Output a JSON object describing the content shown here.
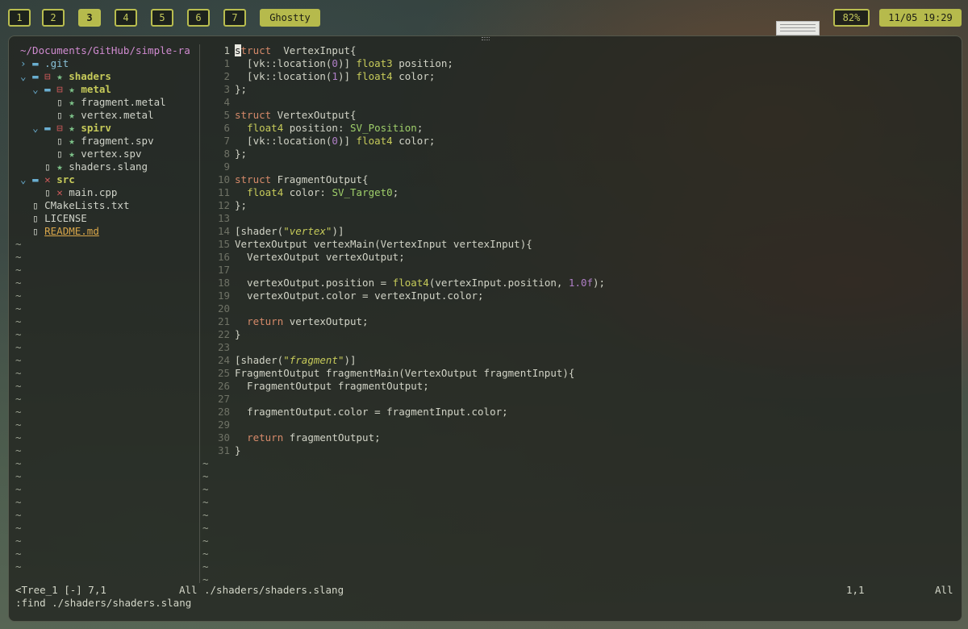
{
  "topbar": {
    "workspaces": [
      "1",
      "2",
      "3",
      "4",
      "5",
      "6",
      "7"
    ],
    "active_workspace": "3",
    "app_label": "Ghostty",
    "battery": "82%",
    "clock": "11/05 19:29"
  },
  "tree": {
    "root": "~/Documents/GitHub/simple-ra",
    "items": [
      {
        "indent": 1,
        "chev": "›",
        "icon": "folder",
        "marks": "",
        "name": ".git",
        "cls": "c-dir"
      },
      {
        "indent": 1,
        "chev": "⌄",
        "icon": "folder",
        "marks": "⊟ ★",
        "name": "shaders",
        "cls": "c-dir-b"
      },
      {
        "indent": 2,
        "chev": "⌄",
        "icon": "folder",
        "marks": "⊟ ★",
        "name": "metal",
        "cls": "c-dir-b"
      },
      {
        "indent": 3,
        "chev": "",
        "icon": "file",
        "marks": "★",
        "name": "fragment.metal",
        "cls": "c-file"
      },
      {
        "indent": 3,
        "chev": "",
        "icon": "file",
        "marks": "★",
        "name": "vertex.metal",
        "cls": "c-file"
      },
      {
        "indent": 2,
        "chev": "⌄",
        "icon": "folder",
        "marks": "⊟ ★",
        "name": "spirv",
        "cls": "c-dir-b"
      },
      {
        "indent": 3,
        "chev": "",
        "icon": "file",
        "marks": "★",
        "name": "fragment.spv",
        "cls": "c-file"
      },
      {
        "indent": 3,
        "chev": "",
        "icon": "file",
        "marks": "★",
        "name": "vertex.spv",
        "cls": "c-file"
      },
      {
        "indent": 2,
        "chev": "",
        "icon": "file",
        "marks": "★",
        "name": "shaders.slang",
        "cls": "c-file"
      },
      {
        "indent": 1,
        "chev": "⌄",
        "icon": "folder",
        "marks": "✕",
        "name": "src",
        "cls": "c-dir-b"
      },
      {
        "indent": 2,
        "chev": "",
        "icon": "file",
        "marks": "✕",
        "name": "main.cpp",
        "cls": "c-file"
      },
      {
        "indent": 1,
        "chev": "",
        "icon": "file",
        "marks": "",
        "name": "CMakeLists.txt",
        "cls": "c-file"
      },
      {
        "indent": 1,
        "chev": "",
        "icon": "file",
        "marks": "",
        "name": "LICENSE",
        "cls": "c-file"
      },
      {
        "indent": 1,
        "chev": "",
        "icon": "file",
        "marks": "",
        "name": "README.md",
        "cls": "c-readme"
      }
    ],
    "tilde_count": 26
  },
  "editor": {
    "lines": [
      {
        "num": "1",
        "cur": true,
        "tokens": [
          [
            "cursor",
            "s"
          ],
          [
            "k",
            "truct"
          ],
          [
            "",
            "  VertexInput{"
          ]
        ]
      },
      {
        "num": "1",
        "tokens": [
          [
            "",
            "  [vk::location("
          ],
          [
            "n",
            "0"
          ],
          [
            "",
            ")] "
          ],
          [
            "t",
            "float3"
          ],
          [
            "",
            " position;"
          ]
        ]
      },
      {
        "num": "2",
        "tokens": [
          [
            "",
            "  [vk::location("
          ],
          [
            "n",
            "1"
          ],
          [
            "",
            ")] "
          ],
          [
            "t",
            "float4"
          ],
          [
            "",
            " color;"
          ]
        ]
      },
      {
        "num": "3",
        "tokens": [
          [
            "",
            "};"
          ]
        ]
      },
      {
        "num": "4",
        "tokens": []
      },
      {
        "num": "5",
        "tokens": [
          [
            "k",
            "struct"
          ],
          [
            "",
            " VertexOutput{"
          ]
        ]
      },
      {
        "num": "6",
        "tokens": [
          [
            "",
            "  "
          ],
          [
            "t",
            "float4"
          ],
          [
            "",
            " position: "
          ],
          [
            "sem",
            "SV_Position"
          ],
          [
            "",
            ";"
          ]
        ]
      },
      {
        "num": "7",
        "tokens": [
          [
            "",
            "  [vk::location("
          ],
          [
            "n",
            "0"
          ],
          [
            "",
            ")] "
          ],
          [
            "t",
            "float4"
          ],
          [
            "",
            " color;"
          ]
        ]
      },
      {
        "num": "8",
        "tokens": [
          [
            "",
            "};"
          ]
        ]
      },
      {
        "num": "9",
        "tokens": []
      },
      {
        "num": "10",
        "tokens": [
          [
            "k",
            "struct"
          ],
          [
            "",
            " FragmentOutput{"
          ]
        ]
      },
      {
        "num": "11",
        "tokens": [
          [
            "",
            "  "
          ],
          [
            "t",
            "float4"
          ],
          [
            "",
            " color: "
          ],
          [
            "sem",
            "SV_Target0"
          ],
          [
            "",
            ";"
          ]
        ]
      },
      {
        "num": "12",
        "tokens": [
          [
            "",
            "};"
          ]
        ]
      },
      {
        "num": "13",
        "tokens": []
      },
      {
        "num": "14",
        "tokens": [
          [
            "",
            "[shader("
          ],
          [
            "s",
            "\"vertex\""
          ],
          [
            "",
            ")]"
          ]
        ]
      },
      {
        "num": "15",
        "tokens": [
          [
            "",
            "VertexOutput vertexMain(VertexInput vertexInput){"
          ]
        ]
      },
      {
        "num": "16",
        "tokens": [
          [
            "",
            "  VertexOutput vertexOutput;"
          ]
        ]
      },
      {
        "num": "17",
        "tokens": []
      },
      {
        "num": "18",
        "tokens": [
          [
            "",
            "  vertexOutput.position = "
          ],
          [
            "t",
            "float4"
          ],
          [
            "",
            "(vertexInput.position, "
          ],
          [
            "n",
            "1.0f"
          ],
          [
            "",
            ");"
          ]
        ]
      },
      {
        "num": "19",
        "tokens": [
          [
            "",
            "  vertexOutput.color = vertexInput.color;"
          ]
        ]
      },
      {
        "num": "20",
        "tokens": []
      },
      {
        "num": "21",
        "tokens": [
          [
            "",
            "  "
          ],
          [
            "k",
            "return"
          ],
          [
            "",
            " vertexOutput;"
          ]
        ]
      },
      {
        "num": "22",
        "tokens": [
          [
            "",
            "}"
          ]
        ]
      },
      {
        "num": "23",
        "tokens": []
      },
      {
        "num": "24",
        "tokens": [
          [
            "",
            "[shader("
          ],
          [
            "s",
            "\"fragment\""
          ],
          [
            "",
            ")]"
          ]
        ]
      },
      {
        "num": "25",
        "tokens": [
          [
            "",
            "FragmentOutput fragmentMain(VertexOutput fragmentInput){"
          ]
        ]
      },
      {
        "num": "26",
        "tokens": [
          [
            "",
            "  FragmentOutput fragmentOutput;"
          ]
        ]
      },
      {
        "num": "27",
        "tokens": []
      },
      {
        "num": "28",
        "tokens": [
          [
            "",
            "  fragmentOutput.color = fragmentInput.color;"
          ]
        ]
      },
      {
        "num": "29",
        "tokens": []
      },
      {
        "num": "30",
        "tokens": [
          [
            "",
            "  "
          ],
          [
            "k",
            "return"
          ],
          [
            "",
            " fragmentOutput;"
          ]
        ]
      },
      {
        "num": "31",
        "tokens": [
          [
            "",
            "}"
          ]
        ]
      }
    ],
    "tilde_count": 10
  },
  "status": {
    "left_name": "<Tree_1 [-] 7,1",
    "left_pos": "All",
    "right_file": "./shaders/shaders.slang",
    "right_pos": "1,1",
    "right_all": "All"
  },
  "cmdline": ":find ./shaders/shaders.slang"
}
